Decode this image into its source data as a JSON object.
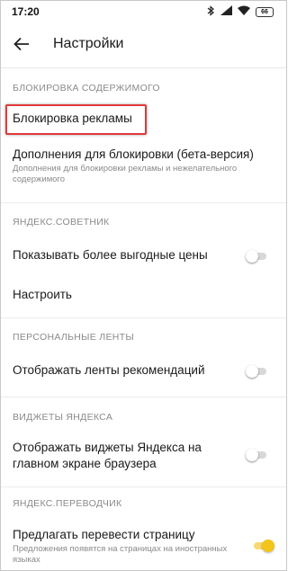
{
  "status_bar": {
    "time": "17:20",
    "icons": [
      "bluetooth-icon",
      "signal-icon",
      "wifi-icon",
      "battery-icon"
    ],
    "battery": "66"
  },
  "app_bar": {
    "title": "Настройки",
    "back_icon": "arrow-left-icon"
  },
  "sections": {
    "content_blocking": {
      "header": "БЛОКИРОВКА СОДЕРЖИМОГО",
      "ad_blocking": "Блокировка рекламы",
      "addons_title": "Дополнения для блокировки (бета-версия)",
      "addons_subtitle": "Дополнения для блокировки рекламы и нежелательного содержимого"
    },
    "advisor": {
      "header": "ЯНДЕКС.СОВЕТНИК",
      "show_prices": "Показывать более выгодные цены",
      "show_prices_enabled": false,
      "configure": "Настроить"
    },
    "feeds": {
      "header": "ПЕРСОНАЛЬНЫЕ ЛЕНТЫ",
      "show_feeds": "Отображать ленты рекомендаций",
      "show_feeds_enabled": false
    },
    "widgets": {
      "header": "ВИДЖЕТЫ ЯНДЕКСА",
      "show_widgets_line1": "Отображать виджеты Яндекса на",
      "show_widgets_line2": "главном экране браузера",
      "show_widgets_enabled": false
    },
    "translator": {
      "header": "ЯНДЕКС.ПЕРЕВОДЧИК",
      "offer_translate": "Предлагать перевести страницу",
      "offer_translate_subtitle": "Предложения появятся на страницах на иностранных языках",
      "offer_translate_enabled": true
    }
  },
  "colors": {
    "highlight": "#e03a3a",
    "toggle_on": "#f3c419",
    "toggle_off": "#d8d8d8"
  }
}
